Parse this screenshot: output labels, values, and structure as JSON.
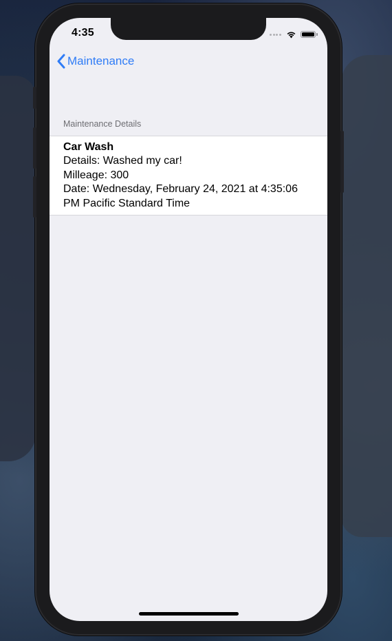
{
  "status_bar": {
    "time": "4:35"
  },
  "navigation": {
    "back_label": "Maintenance",
    "back_icon": "chevron-left-icon",
    "accent_color": "#2f7cf6"
  },
  "section": {
    "header": "Maintenance Details"
  },
  "record": {
    "title": "Car Wash",
    "details": "Details: Washed my car!",
    "mileage": "Milleage: 300",
    "date": "Date:  Wednesday, February 24, 2021 at 4:35:06 PM Pacific Standard Time"
  }
}
